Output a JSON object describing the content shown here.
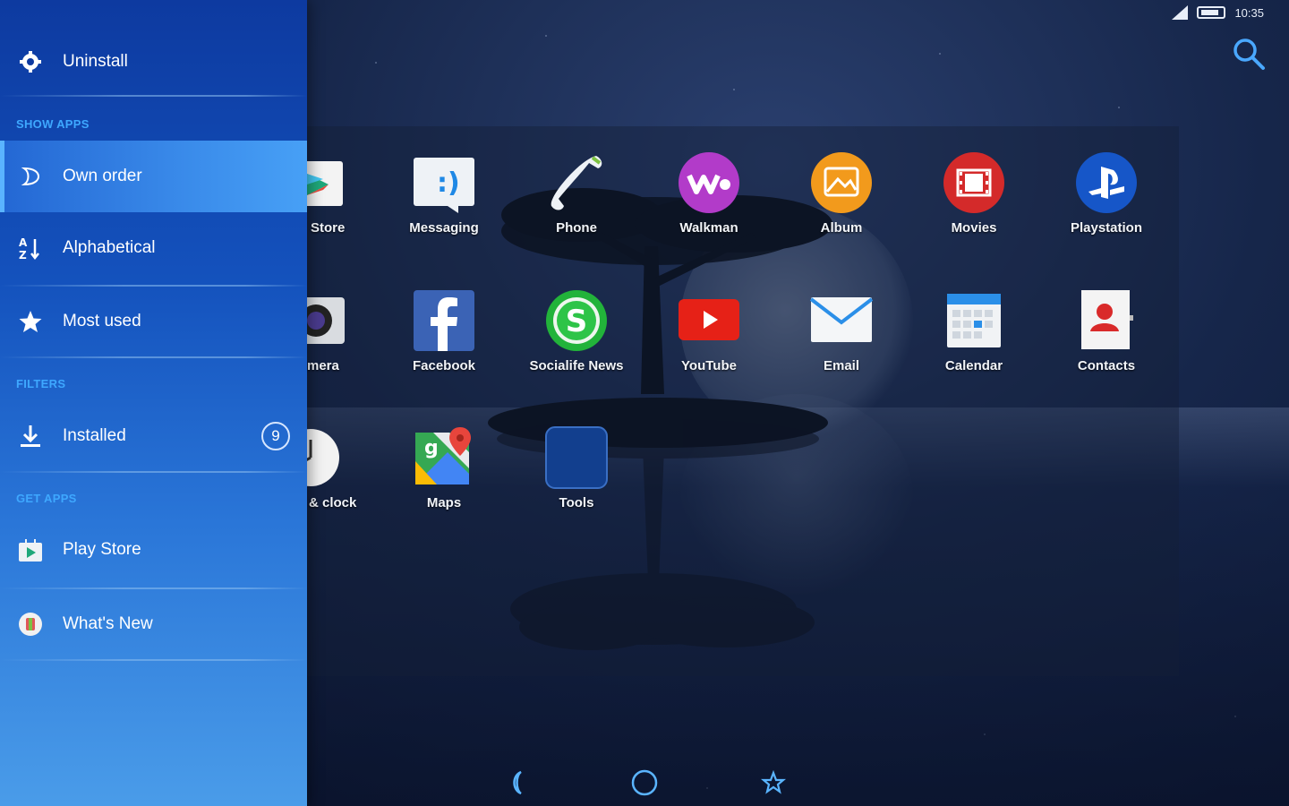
{
  "status_bar": {
    "time": "10:35"
  },
  "drawer": {
    "uninstall": "Uninstall",
    "show_apps_header": "SHOW APPS",
    "own_order": "Own order",
    "alphabetical": "Alphabetical",
    "most_used": "Most used",
    "filters_header": "FILTERS",
    "installed": "Installed",
    "installed_count": "9",
    "get_apps_header": "GET APPS",
    "play_store": "Play Store",
    "whats_new": "What's New"
  },
  "apps": {
    "store": "Store",
    "messaging": "Messaging",
    "phone": "Phone",
    "walkman": "Walkman",
    "album": "Album",
    "movies": "Movies",
    "playstation": "Playstation",
    "camera": "mera",
    "facebook": "Facebook",
    "socialife": "Socialife News",
    "youtube": "YouTube",
    "email": "Email",
    "calendar": "Calendar",
    "contacts": "Contacts",
    "clock": "& clock",
    "maps": "Maps",
    "tools": "Tools"
  },
  "colors": {
    "drawer_top": "#0d3aa0",
    "drawer_bottom": "#4a9ce9",
    "section_header": "#3ea8ff",
    "nav_icon": "#5ab4ff"
  }
}
